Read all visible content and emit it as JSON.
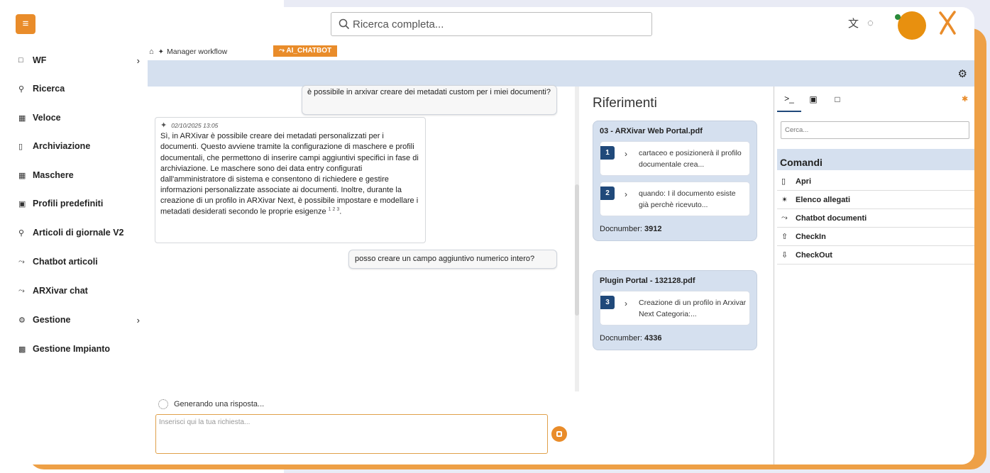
{
  "topbar": {
    "menu_icon": "hamburger-icon",
    "search_placeholder": "Ricerca completa...",
    "icons": [
      "translate-icon",
      "chat-bubbles-icon"
    ],
    "brand_color": "#e98c2a"
  },
  "sidebar": {
    "items": [
      {
        "label": "WF",
        "icon": "folder-icon",
        "has_submenu": true
      },
      {
        "label": "Ricerca",
        "icon": "search-icon",
        "has_submenu": false
      },
      {
        "label": "Veloce",
        "icon": "grid-icon",
        "has_submenu": false
      },
      {
        "label": "Archiviazione",
        "icon": "document-icon",
        "has_submenu": false
      },
      {
        "label": "Maschere",
        "icon": "grid-icon",
        "has_submenu": false
      },
      {
        "label": "Profili predefiniti",
        "icon": "briefcase-icon",
        "has_submenu": false
      },
      {
        "label": "Articoli di giornale V2",
        "icon": "search-text-icon",
        "has_submenu": false
      },
      {
        "label": "Chatbot articoli",
        "icon": "ai-wand-icon",
        "has_submenu": false
      },
      {
        "label": "ARXivar chat",
        "icon": "ai-wand-icon",
        "has_submenu": false
      },
      {
        "label": "Gestione",
        "icon": "gears-icon",
        "has_submenu": true
      },
      {
        "label": "Gestione Impianto",
        "icon": "factory-icon",
        "has_submenu": false
      }
    ]
  },
  "breadcrumb": {
    "workflow": "Manager workflow",
    "active_chip": "AI_CHATBOT"
  },
  "chat": {
    "user_message_1": "è possibile in arxivar creare dei metadati custom per i miei documenti?",
    "bot_timestamp": "02/10/2025 13:05",
    "bot_message": "Sì, in ARXivar è possibile creare dei metadati personalizzati per i documenti. Questo avviene tramite la configurazione di maschere e profili documentali, che permettono di inserire campi aggiuntivi specifici in fase di archiviazione. Le maschere sono dei data entry configurati dall'amministratore di sistema e consentono di richiedere e gestire informazioni personalizzate associate ai documenti. Inoltre, durante la creazione di un profilo in ARXivar Next, è possibile impostare e modellare i metadati desiderati secondo le proprie esigenze",
    "bot_citations": "1 2 3",
    "user_message_2": "posso creare un campo aggiuntivo numerico intero?",
    "generating_text": "Generando una risposta...",
    "input_placeholder": "Inserisci qui la tua richiesta..."
  },
  "references": {
    "title": "Riferimenti",
    "cards": [
      {
        "file": "03 - ARXivar Web Portal.pdf",
        "items": [
          {
            "num": "1",
            "text": "cartaceo e posizionerà il profilo documentale crea..."
          },
          {
            "num": "2",
            "text": "quando: I il documento esiste già perchè ricevuto..."
          }
        ],
        "docnumber_label": "Docnumber:",
        "docnumber": "3912"
      },
      {
        "file": "Plugin Portal - 132128.pdf",
        "items": [
          {
            "num": "3",
            "text": "Creazione di un profilo in Arxivar Next Categoria:..."
          }
        ],
        "docnumber_label": "Docnumber:",
        "docnumber": "4336"
      }
    ]
  },
  "right_panel": {
    "tabs": [
      "terminal-icon",
      "image-icon",
      "file-icon"
    ],
    "search_placeholder": "Cerca...",
    "section_title": "Comandi",
    "commands": [
      {
        "label": "Apri",
        "icon": "file-icon"
      },
      {
        "label": "Elenco allegati",
        "icon": "paperclip-icon"
      },
      {
        "label": "Chatbot documenti",
        "icon": "ai-wand-icon"
      },
      {
        "label": "CheckIn",
        "icon": "upload-icon"
      },
      {
        "label": "CheckOut",
        "icon": "download-icon"
      }
    ]
  }
}
